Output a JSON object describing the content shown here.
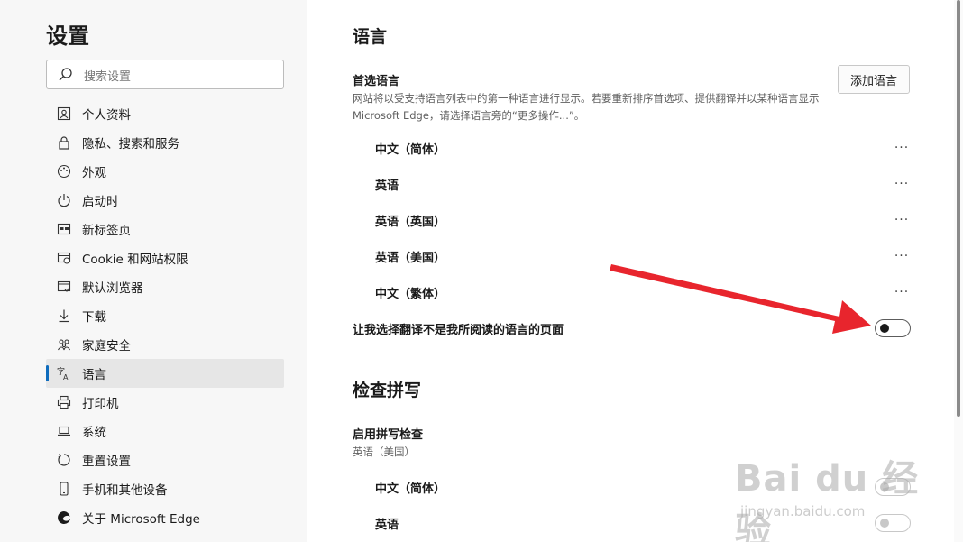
{
  "sidebar": {
    "title": "设置",
    "search": {
      "placeholder": "搜索设置"
    },
    "items": [
      {
        "label": "个人资料",
        "icon": "profile-icon"
      },
      {
        "label": "隐私、搜索和服务",
        "icon": "lock-icon"
      },
      {
        "label": "外观",
        "icon": "palette-icon"
      },
      {
        "label": "启动时",
        "icon": "power-icon"
      },
      {
        "label": "新标签页",
        "icon": "new-tab-icon"
      },
      {
        "label": "Cookie 和网站权限",
        "icon": "site-permissions-icon"
      },
      {
        "label": "默认浏览器",
        "icon": "default-browser-icon"
      },
      {
        "label": "下载",
        "icon": "download-icon"
      },
      {
        "label": "家庭安全",
        "icon": "family-icon"
      },
      {
        "label": "语言",
        "icon": "language-icon",
        "active": true
      },
      {
        "label": "打印机",
        "icon": "printer-icon"
      },
      {
        "label": "系统",
        "icon": "laptop-icon"
      },
      {
        "label": "重置设置",
        "icon": "reset-icon"
      },
      {
        "label": "手机和其他设备",
        "icon": "phone-icon"
      },
      {
        "label": "关于 Microsoft Edge",
        "icon": "edge-logo-icon"
      }
    ]
  },
  "main": {
    "heading": "语言",
    "preferred": {
      "title": "首选语言",
      "description": "网站将以受支持语言列表中的第一种语言进行显示。若要重新排序首选项、提供翻译并以某种语言显示 Microsoft Edge，请选择语言旁的“更多操作...”。",
      "add_button": "添加语言",
      "languages": [
        "中文（简体）",
        "英语",
        "英语（英国）",
        "英语（美国）",
        "中文（繁体）"
      ],
      "more_label": "···"
    },
    "translate_toggle": {
      "label": "让我选择翻译不是我所阅读的语言的页面",
      "on": false
    },
    "spellcheck": {
      "heading": "检查拼写",
      "title": "启用拼写检查",
      "current": "英语（美国）",
      "languages": [
        "中文（简体）",
        "英语"
      ]
    }
  },
  "watermark": {
    "logo": "Bai du 经验",
    "url": "jingyan.baidu.com"
  },
  "colors": {
    "accent": "#0f6cbd",
    "arrow": "#e8252d"
  }
}
